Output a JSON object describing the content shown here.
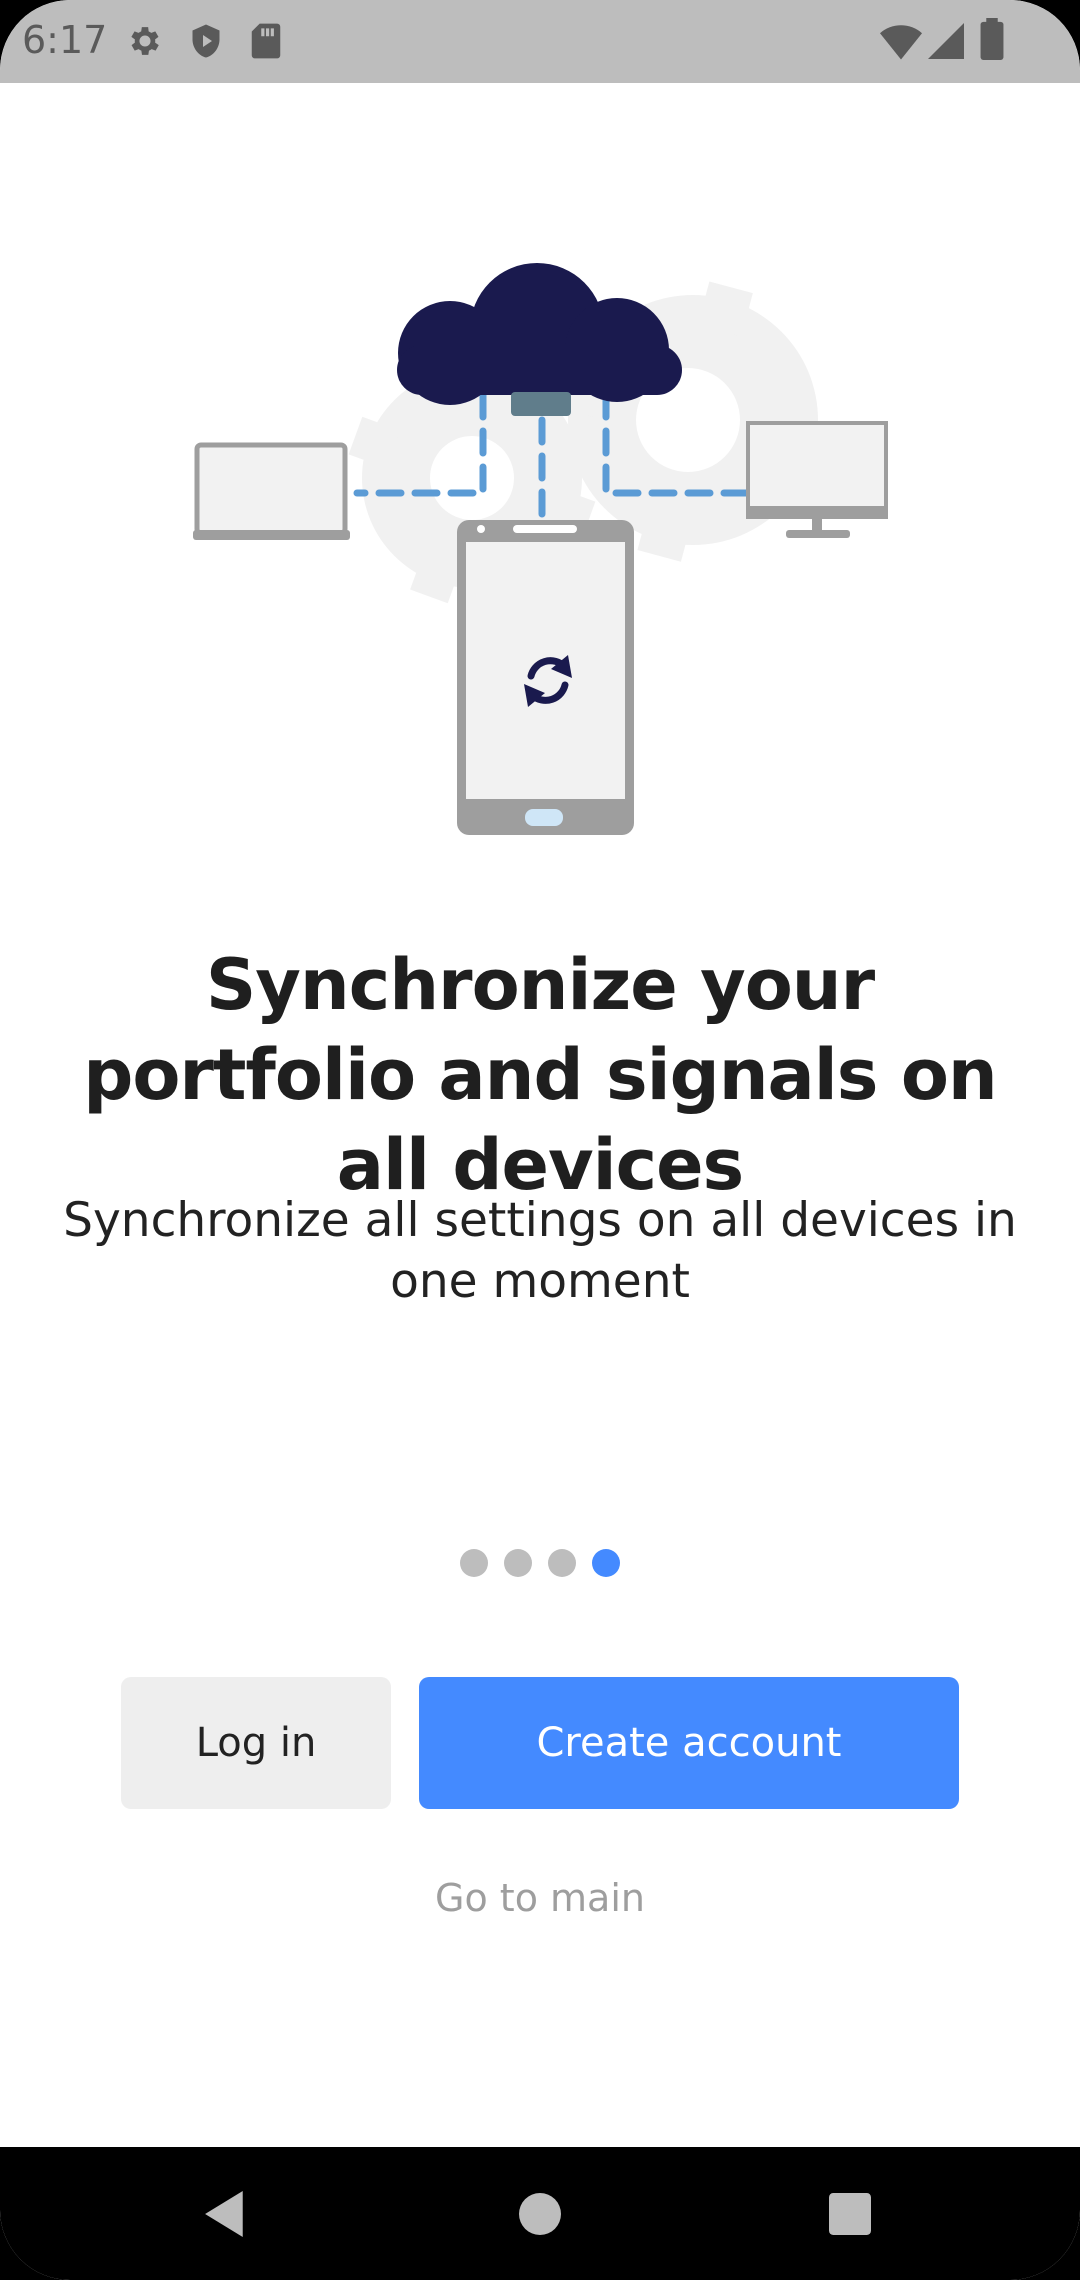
{
  "status_bar": {
    "time": "6:17",
    "icons_left": [
      "gear-icon",
      "shield-play-icon",
      "sd-card-icon"
    ],
    "icons_right": [
      "wifi-icon",
      "signal-icon",
      "battery-icon"
    ]
  },
  "illustration": {
    "elements": [
      "cloud-icon",
      "laptop-icon",
      "phone-icon",
      "monitor-icon",
      "sync-icon",
      "gear-icon"
    ],
    "colors": {
      "cloud": "#1a1a4e",
      "device": "#9e9e9e",
      "screen": "#f2f2f2",
      "dash": "#5b9bd5"
    }
  },
  "onboarding": {
    "headline": "Synchronize your portfolio and signals on all devices",
    "subtext": "Synchronize all settings on all devices in one moment",
    "page_indicator": {
      "total": 4,
      "current": 4
    }
  },
  "actions": {
    "login_label": "Log in",
    "create_account_label": "Create account",
    "go_to_main_label": "Go to main"
  },
  "colors": {
    "accent": "#448aff",
    "secondary_button": "#eeeeee",
    "muted_text": "#9e9e9e"
  },
  "nav_bar": {
    "buttons": [
      "back-icon",
      "home-icon",
      "recents-icon"
    ]
  }
}
